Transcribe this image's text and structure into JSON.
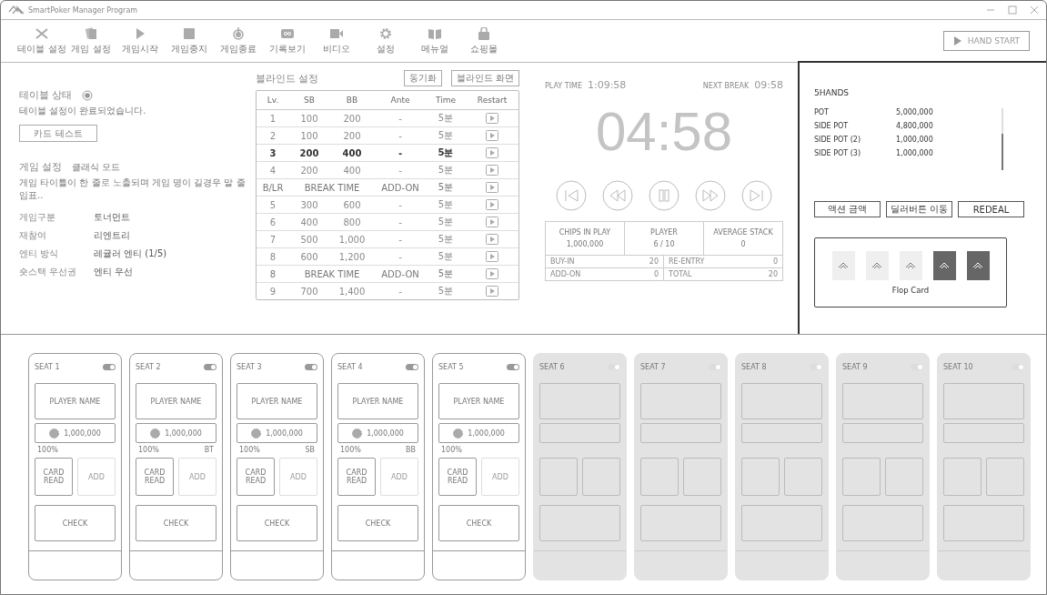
{
  "window": {
    "title": "SmartPoker Manager Program"
  },
  "toolbar": [
    {
      "label": "테이블 설정",
      "kind": "tools"
    },
    {
      "label": "게임 설정",
      "kind": "cards"
    },
    {
      "label": "게임시작",
      "kind": "play"
    },
    {
      "label": "게임중지",
      "kind": "stop"
    },
    {
      "label": "게임종료",
      "kind": "power"
    },
    {
      "label": "기록보기",
      "kind": "record"
    },
    {
      "label": "비디오",
      "kind": "video"
    },
    {
      "label": "설정",
      "kind": "gear"
    },
    {
      "label": "메뉴얼",
      "kind": "book"
    },
    {
      "label": "쇼핑몰",
      "kind": "bag"
    }
  ],
  "hand_start": "HAND START",
  "table_status": {
    "title": "테이블 상태",
    "selected": true,
    "message": "테이블 설정이 완료되었습니다.",
    "button": "카드 테스트"
  },
  "game_settings": {
    "title": "게임 설정",
    "mode": "클래식 모드",
    "description": "게임 타이틀이 한 줄로 노출되며 게임 명이 길경우 말 줄임표..",
    "fields": [
      {
        "label": "게임구분",
        "value": "토너먼트"
      },
      {
        "label": "재참여",
        "value": "리엔트리"
      },
      {
        "label": "엔티 방식",
        "value": "레귤러 엔티 (1/5)"
      },
      {
        "label": "숏스택 우선권",
        "value": "엔티 우선"
      }
    ]
  },
  "blinds": {
    "title": "블라인드 설정",
    "buttons": [
      "동기화",
      "블라인드 화면"
    ],
    "columns": [
      "Lv.",
      "SB",
      "BB",
      "Ante",
      "Time",
      "Restart"
    ],
    "rows": [
      {
        "kind": "level",
        "selected": false,
        "cells": [
          "1",
          "100",
          "200",
          "-",
          "5분"
        ]
      },
      {
        "kind": "level",
        "selected": false,
        "cells": [
          "2",
          "100",
          "200",
          "-",
          "5분"
        ]
      },
      {
        "kind": "level",
        "selected": true,
        "cells": [
          "3",
          "200",
          "400",
          "-",
          "5분"
        ]
      },
      {
        "kind": "level",
        "selected": false,
        "cells": [
          "4",
          "200",
          "400",
          "-",
          "5분"
        ]
      },
      {
        "kind": "break",
        "selected": false,
        "cells": [
          "B/LR",
          "BREAK TIME",
          "ADD-ON",
          "5분"
        ]
      },
      {
        "kind": "level",
        "selected": false,
        "cells": [
          "5",
          "300",
          "600",
          "-",
          "5분"
        ]
      },
      {
        "kind": "level",
        "selected": false,
        "cells": [
          "6",
          "400",
          "800",
          "-",
          "5분"
        ]
      },
      {
        "kind": "level",
        "selected": false,
        "cells": [
          "7",
          "500",
          "1,000",
          "-",
          "5분"
        ]
      },
      {
        "kind": "level",
        "selected": false,
        "cells": [
          "8",
          "600",
          "1,200",
          "-",
          "5분"
        ]
      },
      {
        "kind": "break",
        "selected": false,
        "cells": [
          "8",
          "BREAK TIME",
          "ADD-ON",
          "5분"
        ]
      },
      {
        "kind": "level",
        "selected": false,
        "cells": [
          "9",
          "700",
          "1,400",
          "-",
          "5분"
        ]
      }
    ]
  },
  "timer": {
    "play_time_label": "PLAY TIME",
    "play_time": "1:09:58",
    "next_break_label": "NEXT BREAK",
    "next_break": "09:58",
    "countdown": "04:58",
    "stats": [
      {
        "label": "CHIPS IN PLAY",
        "value": "1,000,000"
      },
      {
        "label": "PLAYER",
        "value": "6 / 10"
      },
      {
        "label": "AVERAGE STACK",
        "value": "0"
      }
    ],
    "totals": [
      {
        "label": "BUY-IN",
        "value": "20"
      },
      {
        "label": "RE-ENTRY",
        "value": "0"
      },
      {
        "label": "ADD-ON",
        "value": "0"
      },
      {
        "label": "TOTAL",
        "value": "20"
      }
    ]
  },
  "hands": {
    "title": "5HANDS",
    "pots": [
      {
        "label": "POT",
        "value": "5,000,000"
      },
      {
        "label": "SIDE POT",
        "value": "4,800,000"
      },
      {
        "label": "SIDE POT (2)",
        "value": "1,000,000"
      },
      {
        "label": "SIDE POT (3)",
        "value": "1,000,000"
      }
    ],
    "buttons": [
      "액션 금액",
      "딜러버튼 이동",
      "REDEAL"
    ],
    "flop": {
      "label": "Flop Card",
      "cards": [
        {
          "dealt": false
        },
        {
          "dealt": false
        },
        {
          "dealt": false
        },
        {
          "dealt": true
        },
        {
          "dealt": true
        }
      ]
    }
  },
  "seats": [
    {
      "label": "SEAT 1",
      "enabled": true,
      "player": "PLAYER NAME",
      "chips": "1,000,000",
      "percent": "100%",
      "card_read": "CARD READ",
      "add": "ADD",
      "check": "CHECK"
    },
    {
      "label": "SEAT 2",
      "enabled": true,
      "player": "PLAYER NAME",
      "chips": "1,000,000",
      "percent": "100%",
      "role": "BT",
      "card_read": "CARD READ",
      "add": "ADD",
      "check": "CHECK"
    },
    {
      "label": "SEAT 3",
      "enabled": true,
      "player": "PLAYER NAME",
      "chips": "1,000,000",
      "percent": "100%",
      "role": "SB",
      "card_read": "CARD READ",
      "add": "ADD",
      "check": "CHECK"
    },
    {
      "label": "SEAT 4",
      "enabled": true,
      "player": "PLAYER NAME",
      "chips": "1,000,000",
      "percent": "100%",
      "role": "BB",
      "card_read": "CARD READ",
      "add": "ADD",
      "check": "CHECK"
    },
    {
      "label": "SEAT 5",
      "enabled": true,
      "player": "PLAYER NAME",
      "chips": "1,000,000",
      "percent": "100%",
      "card_read": "CARD READ",
      "add": "ADD",
      "check": "CHECK"
    },
    {
      "label": "SEAT 6",
      "enabled": false
    },
    {
      "label": "SEAT 7",
      "enabled": false
    },
    {
      "label": "SEAT 8",
      "enabled": false
    },
    {
      "label": "SEAT 9",
      "enabled": false
    },
    {
      "label": "SEAT 10",
      "enabled": false
    }
  ]
}
